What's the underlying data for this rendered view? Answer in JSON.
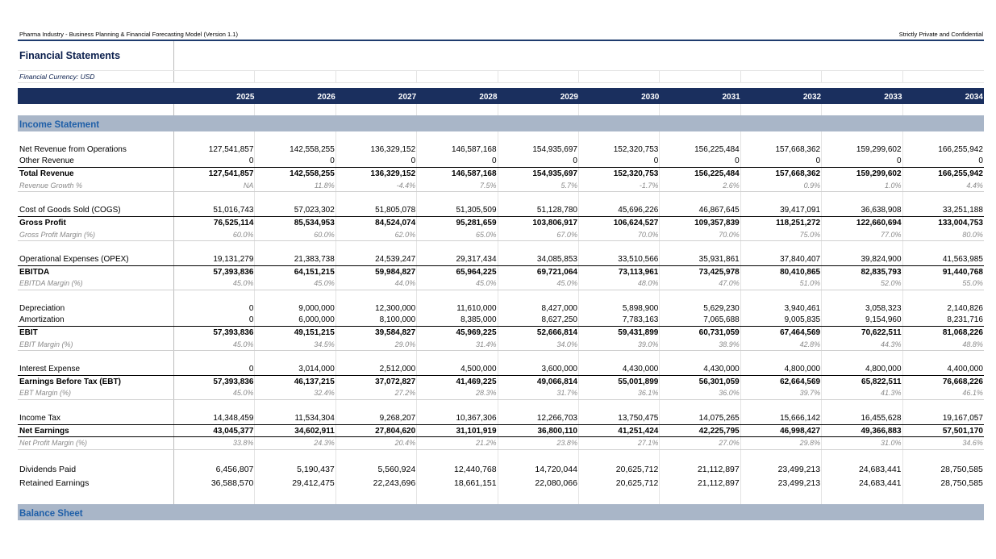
{
  "header": {
    "model_title": "Pharma Industry - Business Planning & Financial Forecasting Model (Version 1.1)",
    "confidentiality": "Strictly Private and Confidential",
    "sheet_title": "Financial Statements",
    "currency_label": "Financial Currency: USD"
  },
  "years": [
    "2025",
    "2026",
    "2027",
    "2028",
    "2029",
    "2030",
    "2031",
    "2032",
    "2033",
    "2034"
  ],
  "sections": {
    "income": "Income Statement",
    "balance": "Balance Sheet"
  },
  "rows": {
    "net_rev": {
      "label": "Net Revenue from Operations",
      "values": [
        "127,541,857",
        "142,558,255",
        "136,329,152",
        "146,587,168",
        "154,935,697",
        "152,320,753",
        "156,225,484",
        "157,668,362",
        "159,299,602",
        "166,255,942"
      ]
    },
    "other_rev": {
      "label": "Other Revenue",
      "values": [
        "0",
        "0",
        "0",
        "0",
        "0",
        "0",
        "0",
        "0",
        "0",
        "0"
      ]
    },
    "total_rev": {
      "label": "Total Revenue",
      "values": [
        "127,541,857",
        "142,558,255",
        "136,329,152",
        "146,587,168",
        "154,935,697",
        "152,320,753",
        "156,225,484",
        "157,668,362",
        "159,299,602",
        "166,255,942"
      ]
    },
    "rev_growth": {
      "label": "Revenue Growth %",
      "values": [
        "NA",
        "11.8%",
        "-4.4%",
        "7.5%",
        "5.7%",
        "-1.7%",
        "2.6%",
        "0.9%",
        "1.0%",
        "4.4%"
      ]
    },
    "cogs": {
      "label": "Cost of Goods Sold (COGS)",
      "values": [
        "51,016,743",
        "57,023,302",
        "51,805,078",
        "51,305,509",
        "51,128,780",
        "45,696,226",
        "46,867,645",
        "39,417,091",
        "36,638,908",
        "33,251,188"
      ]
    },
    "gross_profit": {
      "label": "Gross Profit",
      "values": [
        "76,525,114",
        "85,534,953",
        "84,524,074",
        "95,281,659",
        "103,806,917",
        "106,624,527",
        "109,357,839",
        "118,251,272",
        "122,660,694",
        "133,004,753"
      ]
    },
    "gp_margin": {
      "label": "Gross Profit Margin (%)",
      "values": [
        "60.0%",
        "60.0%",
        "62.0%",
        "65.0%",
        "67.0%",
        "70.0%",
        "70.0%",
        "75.0%",
        "77.0%",
        "80.0%"
      ]
    },
    "opex": {
      "label": "Operational Expenses (OPEX)",
      "values": [
        "19,131,279",
        "21,383,738",
        "24,539,247",
        "29,317,434",
        "34,085,853",
        "33,510,566",
        "35,931,861",
        "37,840,407",
        "39,824,900",
        "41,563,985"
      ]
    },
    "ebitda": {
      "label": "EBITDA",
      "values": [
        "57,393,836",
        "64,151,215",
        "59,984,827",
        "65,964,225",
        "69,721,064",
        "73,113,961",
        "73,425,978",
        "80,410,865",
        "82,835,793",
        "91,440,768"
      ]
    },
    "ebitda_margin": {
      "label": "EBITDA Margin (%)",
      "values": [
        "45.0%",
        "45.0%",
        "44.0%",
        "45.0%",
        "45.0%",
        "48.0%",
        "47.0%",
        "51.0%",
        "52.0%",
        "55.0%"
      ]
    },
    "depreciation": {
      "label": "Depreciation",
      "values": [
        "0",
        "9,000,000",
        "12,300,000",
        "11,610,000",
        "8,427,000",
        "5,898,900",
        "5,629,230",
        "3,940,461",
        "3,058,323",
        "2,140,826"
      ]
    },
    "amortization": {
      "label": "Amortization",
      "values": [
        "0",
        "6,000,000",
        "8,100,000",
        "8,385,000",
        "8,627,250",
        "7,783,163",
        "7,065,688",
        "9,005,835",
        "9,154,960",
        "8,231,716"
      ]
    },
    "ebit": {
      "label": "EBIT",
      "values": [
        "57,393,836",
        "49,151,215",
        "39,584,827",
        "45,969,225",
        "52,666,814",
        "59,431,899",
        "60,731,059",
        "67,464,569",
        "70,622,511",
        "81,068,226"
      ]
    },
    "ebit_margin": {
      "label": "EBIT Margin (%)",
      "values": [
        "45.0%",
        "34.5%",
        "29.0%",
        "31.4%",
        "34.0%",
        "39.0%",
        "38.9%",
        "42.8%",
        "44.3%",
        "48.8%"
      ]
    },
    "interest": {
      "label": "Interest Expense",
      "values": [
        "0",
        "3,014,000",
        "2,512,000",
        "4,500,000",
        "3,600,000",
        "4,430,000",
        "4,430,000",
        "4,800,000",
        "4,800,000",
        "4,400,000"
      ]
    },
    "ebt": {
      "label": "Earnings Before Tax (EBT)",
      "values": [
        "57,393,836",
        "46,137,215",
        "37,072,827",
        "41,469,225",
        "49,066,814",
        "55,001,899",
        "56,301,059",
        "62,664,569",
        "65,822,511",
        "76,668,226"
      ]
    },
    "ebt_margin": {
      "label": "EBT Margin (%)",
      "values": [
        "45.0%",
        "32.4%",
        "27.2%",
        "28.3%",
        "31.7%",
        "36.1%",
        "36.0%",
        "39.7%",
        "41.3%",
        "46.1%"
      ]
    },
    "tax": {
      "label": "Income Tax",
      "values": [
        "14,348,459",
        "11,534,304",
        "9,268,207",
        "10,367,306",
        "12,266,703",
        "13,750,475",
        "14,075,265",
        "15,666,142",
        "16,455,628",
        "19,167,057"
      ]
    },
    "net_earnings": {
      "label": "Net Earnings",
      "values": [
        "43,045,377",
        "34,602,911",
        "27,804,620",
        "31,101,919",
        "36,800,110",
        "41,251,424",
        "42,225,795",
        "46,998,427",
        "49,366,883",
        "57,501,170"
      ]
    },
    "np_margin": {
      "label": "Net Profit Margin (%)",
      "values": [
        "33.8%",
        "24.3%",
        "20.4%",
        "21.2%",
        "23.8%",
        "27.1%",
        "27.0%",
        "29.8%",
        "31.0%",
        "34.6%"
      ]
    },
    "dividends": {
      "label": "Dividends Paid",
      "values": [
        "6,456,807",
        "5,190,437",
        "5,560,924",
        "12,440,768",
        "14,720,044",
        "20,625,712",
        "21,112,897",
        "23,499,213",
        "24,683,441",
        "28,750,585"
      ]
    },
    "retained": {
      "label": "Retained Earnings",
      "values": [
        "36,588,570",
        "29,412,475",
        "22,243,696",
        "18,661,151",
        "22,080,066",
        "20,625,712",
        "21,112,897",
        "23,499,213",
        "24,683,441",
        "28,750,585"
      ]
    }
  }
}
